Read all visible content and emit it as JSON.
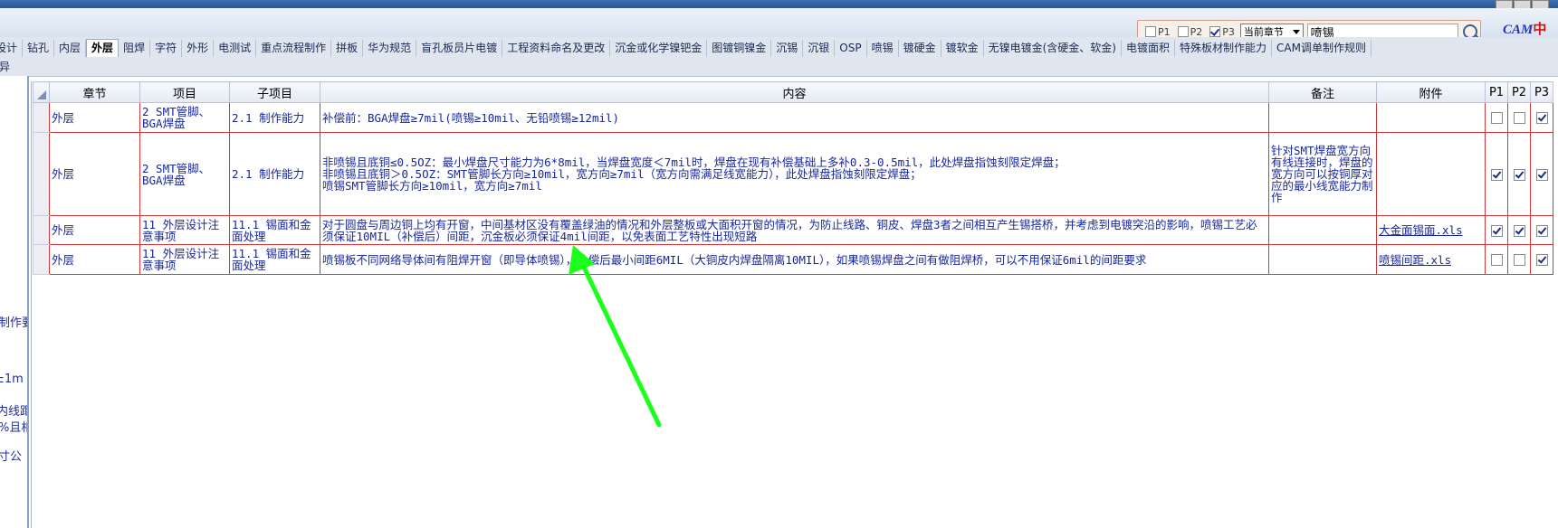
{
  "search": {
    "p1_label": "P1",
    "p2_label": "P2",
    "p3_label": "P3",
    "p1_checked": false,
    "p2_checked": false,
    "p3_checked": true,
    "scope_value": "当前章节",
    "query": "喷锡"
  },
  "logo": {
    "part1": "CAM",
    "part2": "中心"
  },
  "tabs": [
    {
      "label": "设计"
    },
    {
      "label": "钻孔"
    },
    {
      "label": "内层"
    },
    {
      "label": "外层",
      "active": true
    },
    {
      "label": "阻焊"
    },
    {
      "label": "字符"
    },
    {
      "label": "外形"
    },
    {
      "label": "电测试"
    },
    {
      "label": "重点流程制作"
    },
    {
      "label": "拼板"
    },
    {
      "label": "华为规范"
    },
    {
      "label": "盲孔板员片电镀"
    },
    {
      "label": "工程资料命名及更改"
    },
    {
      "label": "沉金或化学镍钯金"
    },
    {
      "label": "图镀铜镍金"
    },
    {
      "label": "沉锡"
    },
    {
      "label": "沉银"
    },
    {
      "label": "OSP"
    },
    {
      "label": "喷锡"
    },
    {
      "label": "镀硬金"
    },
    {
      "label": "镀软金"
    },
    {
      "label": "无镍电镀金(含硬金、软金)"
    },
    {
      "label": "电镀面积"
    },
    {
      "label": "特殊板材制作能力"
    },
    {
      "label": "CAM调单制作规则"
    }
  ],
  "tabs_row2": [
    "异"
  ],
  "left_pane": [
    "制作要",
    "±1m",
    "内线距",
    "%且相",
    "寸公"
  ],
  "table": {
    "headers": {
      "chapter": "章节",
      "item": "项目",
      "subitem": "子项目",
      "content": "内容",
      "remark": "备注",
      "attachment": "附件",
      "p1": "P1",
      "p2": "P2",
      "p3": "P3"
    },
    "rows": [
      {
        "chapter": "外层",
        "item": "2 SMT管脚、BGA焊盘",
        "subitem": "2.1 制作能力",
        "content": "补偿前：BGA焊盘≥7mil(喷锡≥10mil、无铅喷锡≥12mil)",
        "remark": "",
        "attachment": "",
        "p1": false,
        "p2": false,
        "p3": true
      },
      {
        "chapter": "外层",
        "item": "2 SMT管脚、BGA焊盘",
        "subitem": "2.1 制作能力",
        "content": "非喷锡且底铜≤0.5OZ：最小焊盘尺寸能力为6*8mil，当焊盘宽度＜7mil时，焊盘在现有补偿基础上多补0.3-0.5mil，此处焊盘指蚀刻限定焊盘；\n非喷锡且底铜＞0.5OZ：SMT管脚长方向≥10mil，宽方向≥7mil（宽方向需满足线宽能力），此处焊盘指蚀刻限定焊盘；\n喷锡SMT管脚长方向≥10mil，宽方向≥7mil",
        "remark": "针对SMT焊盘宽方向有线连接时，焊盘的宽方向可以按铜厚对应的最小线宽能力制作",
        "attachment": "",
        "p1": true,
        "p2": true,
        "p3": true
      },
      {
        "chapter": "外层",
        "item": "11 外层设计注意事项",
        "subitem": "11.1 锡面和金面处理",
        "content": "对于圆盘与周边铜上均有开窗，中间基材区没有覆盖绿油的情况和外层整板或大面积开窗的情况，为防止线路、铜皮、焊盘3者之间相互产生锡搭桥，并考虑到电镀突沿的影响，喷锡工艺必须保证10MIL（补偿后）间距，沉金板必须保证4mil间距，以免表面工艺特性出现短路",
        "remark": "",
        "attachment": "大金面锡面.xls",
        "p1": true,
        "p2": true,
        "p3": true
      },
      {
        "chapter": "外层",
        "item": "11 外层设计注意事项",
        "subitem": "11.1 锡面和金面处理",
        "content": "喷锡板不同网络导体间有阻焊开窗（即导体喷锡），补偿后最小间距6MIL（大铜皮内焊盘隔离10MIL），如果喷锡焊盘之间有做阻焊桥，可以不用保证6mil的间距要求",
        "remark": "",
        "attachment": "喷锡间距.xls",
        "p1": false,
        "p2": false,
        "p3": true
      }
    ]
  },
  "annotation": {
    "arrow_color": "#1cff1c"
  }
}
